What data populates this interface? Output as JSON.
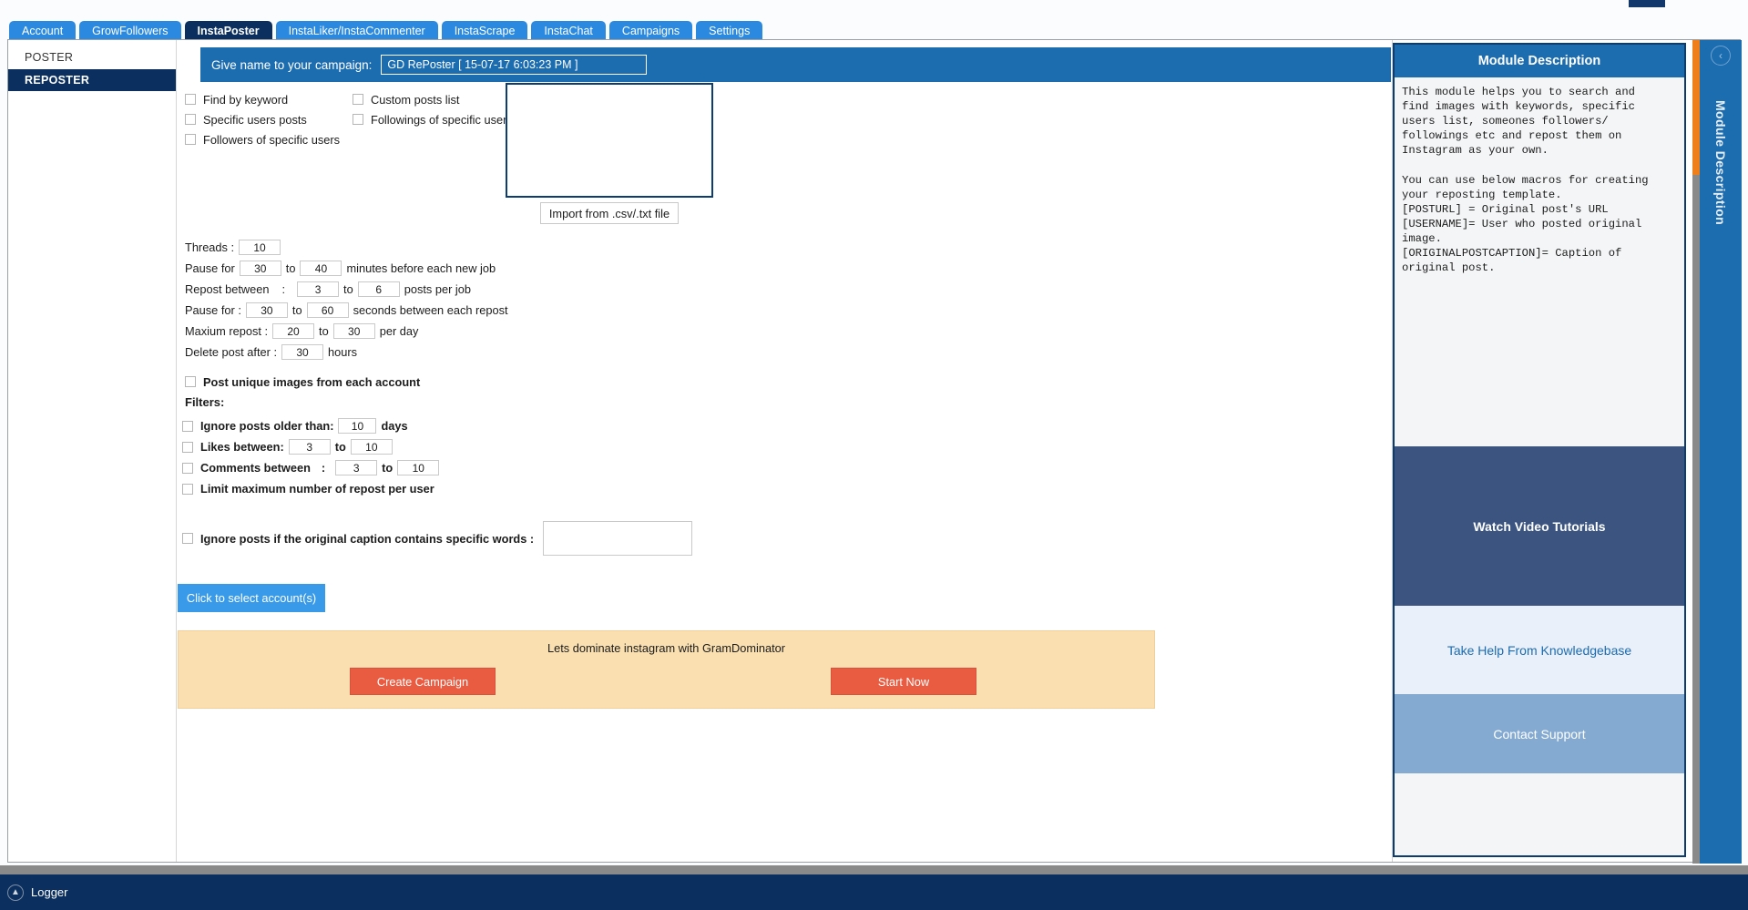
{
  "tabs": [
    {
      "label": "Account",
      "active": false
    },
    {
      "label": "GrowFollowers",
      "active": false
    },
    {
      "label": "InstaPoster",
      "active": true
    },
    {
      "label": "InstaLiker/InstaCommenter",
      "active": false
    },
    {
      "label": "InstaScrape",
      "active": false
    },
    {
      "label": "InstaChat",
      "active": false
    },
    {
      "label": "Campaigns",
      "active": false
    },
    {
      "label": "Settings",
      "active": false
    }
  ],
  "sidebar": {
    "heading": "POSTER",
    "items": [
      {
        "label": "REPOSTER",
        "selected": true
      }
    ]
  },
  "campaign": {
    "label": "Give name to your campaign:",
    "value": "GD RePoster [ 15-07-17 6:03:23 PM ]",
    "placeholder": ""
  },
  "sources": {
    "col1": [
      {
        "label": "Find by keyword",
        "checked": false
      },
      {
        "label": "Specific users posts",
        "checked": false
      },
      {
        "label": "Followers of specific users",
        "checked": false
      }
    ],
    "col2": [
      {
        "label": "Custom posts list",
        "checked": false
      },
      {
        "label": "Followings of specific users",
        "checked": false
      }
    ],
    "post_box_value": "",
    "import_button": "Import from .csv/.txt file"
  },
  "settings": {
    "threads_label": "Threads :",
    "threads_value": "10",
    "pause_job_pre": "Pause for",
    "pause_job_from": "30",
    "pause_job_to_word": "to",
    "pause_job_to": "40",
    "pause_job_post": "minutes before each new job",
    "repost_pre": "Repost between",
    "repost_colon": ":",
    "repost_from": "3",
    "repost_to_word": "to",
    "repost_to": "6",
    "repost_post": "posts per job",
    "pause_repost_pre": "Pause for :",
    "pause_repost_from": "30",
    "pause_repost_to_word": "to",
    "pause_repost_to": "60",
    "pause_repost_post": "seconds between each repost",
    "max_repost_pre": "Maxium repost :",
    "max_repost_from": "20",
    "max_repost_to_word": "to",
    "max_repost_to": "30",
    "max_repost_post": "per day",
    "delete_post_pre": "Delete post after :",
    "delete_post_value": "30",
    "delete_post_post": "hours",
    "unique_images_label": "Post unique images from each account",
    "unique_images_checked": false
  },
  "filters": {
    "title": "Filters:",
    "older_than_label": "Ignore posts older than:",
    "older_than_value": "10",
    "older_than_unit": "days",
    "older_than_checked": false,
    "likes_label": "Likes between:",
    "likes_from": "3",
    "likes_to_word": "to",
    "likes_to": "10",
    "likes_checked": false,
    "comments_label": "Comments between",
    "comments_colon": ":",
    "comments_from": "3",
    "comments_to_word": "to",
    "comments_to": "10",
    "comments_checked": false,
    "limit_repost_label": "Limit maximum number of repost per user",
    "limit_repost_checked": false,
    "caption_label": "Ignore posts if the original caption contains specific words :",
    "caption_value": "",
    "caption_checked": false
  },
  "actions": {
    "select_accounts": "Click to select account(s)",
    "tagline": "Lets dominate instagram with GramDominator",
    "create_campaign": "Create Campaign",
    "start_now": "Start Now"
  },
  "module_panel": {
    "title": "Module Description",
    "body": "This module helps you to search and\nfind images with keywords, specific\nusers list, someones followers/\nfollowings etc and repost them on\nInstagram as your own.\n\nYou can use below macros for creating\nyour reposting template.\n[POSTURL] = Original post's URL\n[USERNAME]= User who posted original\nimage.\n[ORIGINALPOSTCAPTION]= Caption of\noriginal post.",
    "watch_video": "Watch Video Tutorials",
    "knowledgebase": "Take Help From Knowledgebase",
    "contact_support": "Contact Support",
    "vertical_tab": "Module Description",
    "collapse_glyph": "‹"
  },
  "logger": {
    "label": "Logger",
    "glyph": "▲"
  },
  "colors": {
    "tab_blue": "#2b8ae0",
    "tab_active": "#0b2f5e",
    "header_blue": "#1c6cb0",
    "accent_orange": "#ef7f1a",
    "button_orange": "#ea5c42",
    "tan": "#fadfb0",
    "select_button": "#389ae8",
    "video_panel": "#3b5480",
    "support_panel": "#85aad1"
  }
}
